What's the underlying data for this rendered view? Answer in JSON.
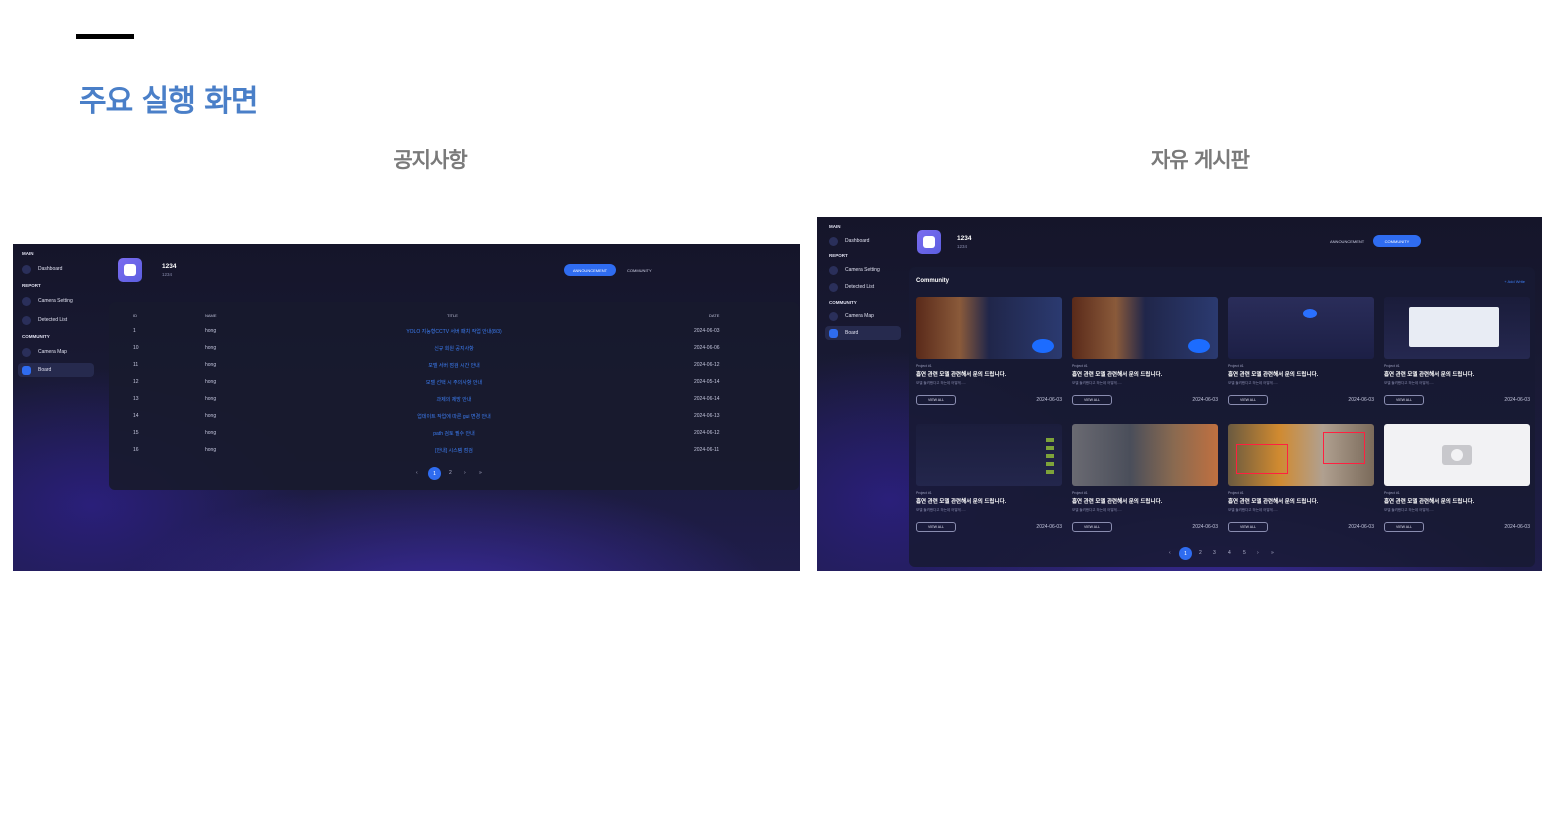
{
  "heading": "주요 실행 화면",
  "captions": {
    "left": "공지사항",
    "right": "자유 게시판"
  },
  "app": {
    "sidebar": {
      "main": "MAIN",
      "dashboard": "Dashboard",
      "report": "REPORT",
      "camera_setting": "Camera Setting",
      "detected_list": "Detected List",
      "community": "COMMUNITY",
      "camera_map": "Camera Map",
      "board": "Board"
    },
    "user": {
      "name": "1234",
      "id": "1234"
    },
    "tabs": {
      "announcement": "ANNOUNCEMENT",
      "community": "COMMUNITY"
    }
  },
  "notice": {
    "columns": [
      "ID",
      "NAME",
      "TITLE",
      "DATE"
    ],
    "rows": [
      [
        "1",
        "hong",
        "YOLO 지능형CCTV 서버 패치 작업 안내(8/3)",
        "2024-06-03"
      ],
      [
        "10",
        "hong",
        "신규 회원 공지사항",
        "2024-06-06"
      ],
      [
        "11",
        "hong",
        "모델 서버 점검 시간 안내",
        "2024-06-12"
      ],
      [
        "12",
        "hong",
        "모델 선택 시 주의사항 안내",
        "2024-05-14"
      ],
      [
        "13",
        "hong",
        "과제의 제방 안내",
        "2024-06-14"
      ],
      [
        "14",
        "hong",
        "업데이트 작업에 따른 gui 변경 안내",
        "2024-06-13"
      ],
      [
        "15",
        "hong",
        "path 검토 필수 안내",
        "2024-06-12"
      ],
      [
        "16",
        "hong",
        "[안내] 시스템 점검",
        "2024-06-11"
      ]
    ],
    "pagination": {
      "prev": "‹",
      "pages": [
        "1",
        "2"
      ],
      "next": "›",
      "last": "»"
    }
  },
  "board": {
    "title": "Community",
    "add": "+ Add Write",
    "cards": [
      {
        "tag": "Project #1",
        "title": "흡연 관련 모델 관련해서 문의 드립니다.",
        "desc": "모델 돌려봤다고 하는데 어떻게.....",
        "btn": "VIEW ALL",
        "date": "2024-06-03",
        "thumb": "ta"
      },
      {
        "tag": "Project #1",
        "title": "흡연 관련 모델 관련해서 문의 드립니다.",
        "desc": "모델 돌려봤다고 하는데 어떻게.....",
        "btn": "VIEW ALL",
        "date": "2024-06-03",
        "thumb": "ta"
      },
      {
        "tag": "Project #1",
        "title": "흡연 관련 모델 관련해서 문의 드립니다.",
        "desc": "모델 돌려봤다고 하는데 어떻게.....",
        "btn": "VIEW ALL",
        "date": "2024-06-03",
        "thumb": "tb"
      },
      {
        "tag": "Project #1",
        "title": "흡연 관련 모델 관련해서 문의 드립니다.",
        "desc": "모델 돌려봤다고 하는데 어떻게.....",
        "btn": "VIEW ALL",
        "date": "2024-06-03",
        "thumb": "tc"
      },
      {
        "tag": "Project #1",
        "title": "흡연 관련 모델 관련해서 문의 드립니다.",
        "desc": "모델 돌려봤다고 하는데 어떻게.....",
        "btn": "VIEW ALL",
        "date": "2024-06-03",
        "thumb": "td2"
      },
      {
        "tag": "Project #1",
        "title": "흡연 관련 모델 관련해서 문의 드립니다.",
        "desc": "모델 돌려봤다고 하는데 어떻게.....",
        "btn": "VIEW ALL",
        "date": "2024-06-03",
        "thumb": "te"
      },
      {
        "tag": "Project #1",
        "title": "흡연 관련 모델 관련해서 문의 드립니다.",
        "desc": "모델 돌려봤다고 하는데 어떻게.....",
        "btn": "VIEW ALL",
        "date": "2024-06-03",
        "thumb": "tf"
      },
      {
        "tag": "Project #1",
        "title": "흡연 관련 모델 관련해서 문의 드립니다.",
        "desc": "모델 돌려봤다고 하는데 어떻게.....",
        "btn": "VIEW ALL",
        "date": "2024-06-03",
        "thumb": "tg"
      }
    ],
    "pagination": {
      "prev": "‹",
      "pages": [
        "1",
        "2",
        "3",
        "4",
        "5"
      ],
      "next": "›",
      "last": "»"
    }
  }
}
